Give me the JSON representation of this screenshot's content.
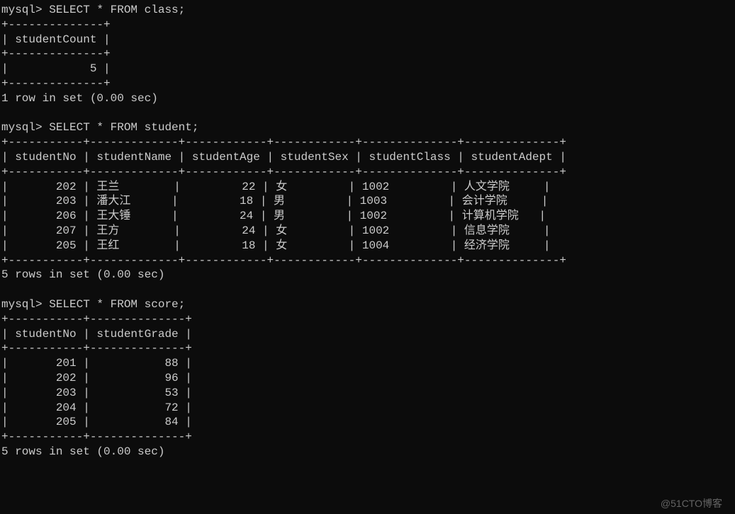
{
  "prompt": "mysql>",
  "queries": {
    "q1": {
      "sql": "SELECT * FROM class;",
      "columns": [
        "studentCount"
      ],
      "rows": [
        {
          "studentCount": 5
        }
      ],
      "footer": "1 row in set (0.00 sec)"
    },
    "q2": {
      "sql": "SELECT * FROM student;",
      "columns": [
        "studentNo",
        "studentName",
        "studentAge",
        "studentSex",
        "studentClass",
        "studentAdept"
      ],
      "rows": [
        {
          "studentNo": 202,
          "studentName": "王兰",
          "studentAge": 22,
          "studentSex": "女",
          "studentClass": "1002",
          "studentAdept": "人文学院"
        },
        {
          "studentNo": 203,
          "studentName": "潘大江",
          "studentAge": 18,
          "studentSex": "男",
          "studentClass": "1003",
          "studentAdept": "会计学院"
        },
        {
          "studentNo": 206,
          "studentName": "王大锤",
          "studentAge": 24,
          "studentSex": "男",
          "studentClass": "1002",
          "studentAdept": "计算机学院"
        },
        {
          "studentNo": 207,
          "studentName": "王方",
          "studentAge": 24,
          "studentSex": "女",
          "studentClass": "1002",
          "studentAdept": "信息学院"
        },
        {
          "studentNo": 205,
          "studentName": "王红",
          "studentAge": 18,
          "studentSex": "女",
          "studentClass": "1004",
          "studentAdept": "经济学院"
        }
      ],
      "footer": "5 rows in set (0.00 sec)"
    },
    "q3": {
      "sql": "SELECT * FROM score;",
      "columns": [
        "studentNo",
        "studentGrade"
      ],
      "rows": [
        {
          "studentNo": 201,
          "studentGrade": 88
        },
        {
          "studentNo": 202,
          "studentGrade": 96
        },
        {
          "studentNo": 203,
          "studentGrade": 53
        },
        {
          "studentNo": 204,
          "studentGrade": 72
        },
        {
          "studentNo": 205,
          "studentGrade": 84
        }
      ],
      "footer": "5 rows in set (0.00 sec)"
    }
  },
  "watermark": "@51CTO博客",
  "chart_data": [
    {
      "type": "table",
      "title": "class",
      "columns": [
        "studentCount"
      ],
      "rows": [
        [
          5
        ]
      ]
    },
    {
      "type": "table",
      "title": "student",
      "columns": [
        "studentNo",
        "studentName",
        "studentAge",
        "studentSex",
        "studentClass",
        "studentAdept"
      ],
      "rows": [
        [
          202,
          "王兰",
          22,
          "女",
          "1002",
          "人文学院"
        ],
        [
          203,
          "潘大江",
          18,
          "男",
          "1003",
          "会计学院"
        ],
        [
          206,
          "王大锤",
          24,
          "男",
          "1002",
          "计算机学院"
        ],
        [
          207,
          "王方",
          24,
          "女",
          "1002",
          "信息学院"
        ],
        [
          205,
          "王红",
          18,
          "女",
          "1004",
          "经济学院"
        ]
      ]
    },
    {
      "type": "table",
      "title": "score",
      "columns": [
        "studentNo",
        "studentGrade"
      ],
      "rows": [
        [
          201,
          88
        ],
        [
          202,
          96
        ],
        [
          203,
          53
        ],
        [
          204,
          72
        ],
        [
          205,
          84
        ]
      ]
    }
  ]
}
